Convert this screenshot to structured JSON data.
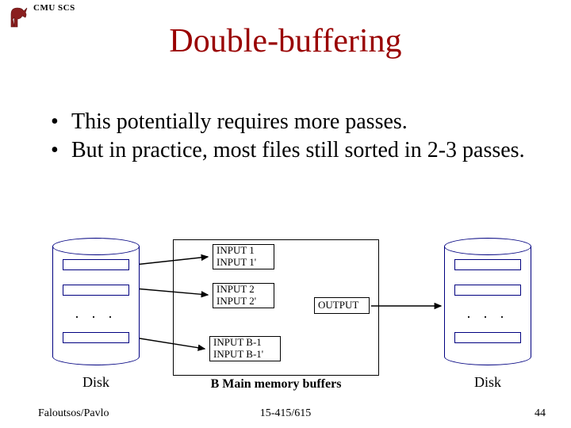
{
  "header": {
    "org": "CMU SCS"
  },
  "title": "Double-buffering",
  "bullets": [
    "This potentially requires more passes.",
    "But in practice, most files still sorted in 2-3 passes."
  ],
  "diagram": {
    "left_disk": {
      "label": "Disk",
      "ellipsis": ".  .  ."
    },
    "right_disk": {
      "label": "Disk",
      "ellipsis": ".  .  ."
    },
    "buffers": {
      "in1a": "INPUT 1",
      "in1b": "INPUT 1'",
      "in2a": "INPUT 2",
      "in2b": "INPUT 2'",
      "inBa": "INPUT B-1",
      "inBb": "INPUT B-1'",
      "out": "OUTPUT"
    },
    "mem_caption": "B Main memory buffers"
  },
  "footer": {
    "left": "Faloutsos/Pavlo",
    "center": "15-415/615",
    "right": "44"
  },
  "colors": {
    "title": "#990000",
    "cylinder": "#000080"
  }
}
